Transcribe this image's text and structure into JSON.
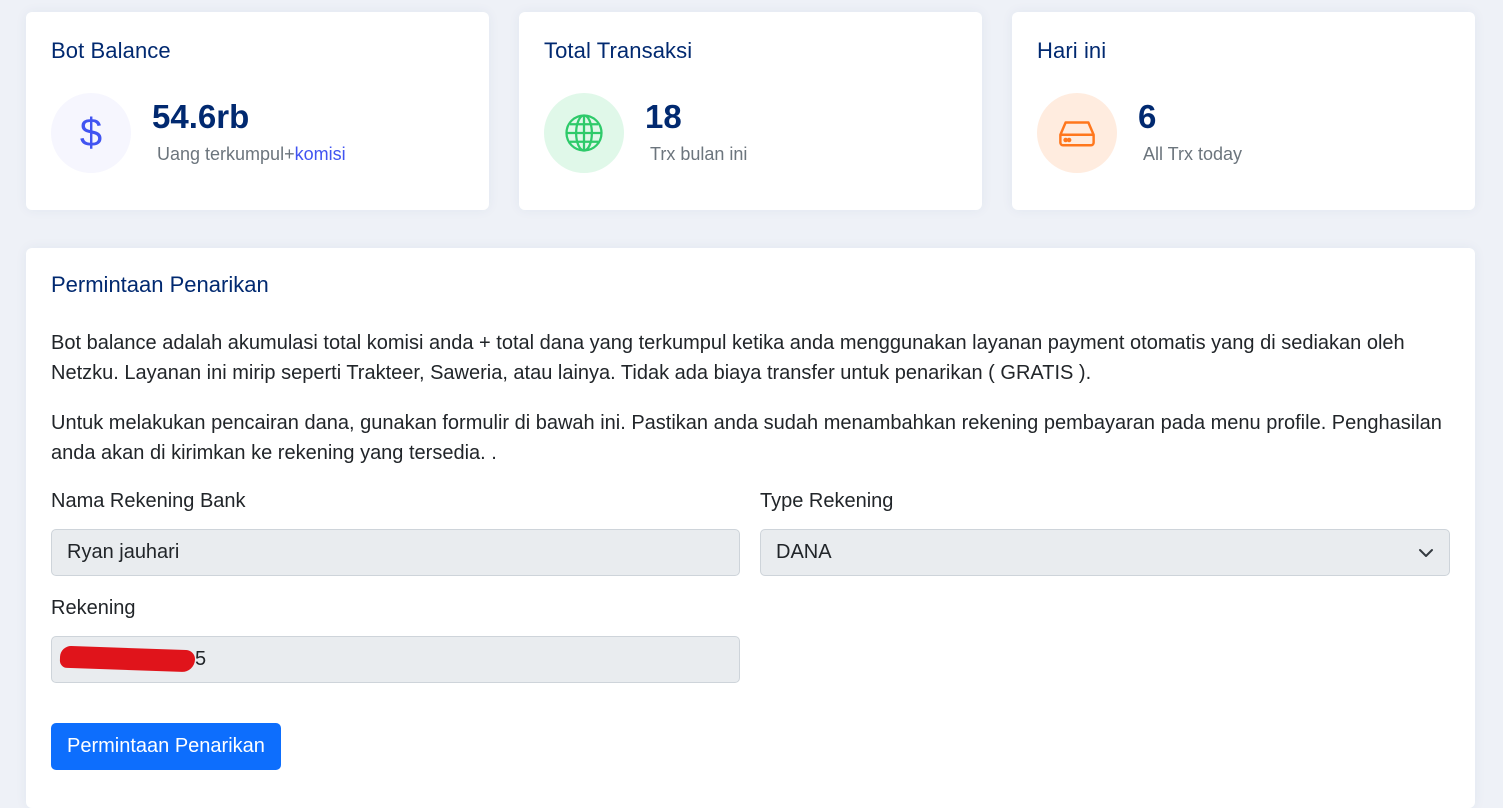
{
  "cards": {
    "balance": {
      "title": "Bot Balance",
      "icon": "dollar-icon",
      "value": "54.6rb",
      "sub_prefix": "Uang terkumpul+",
      "sub_accent": "komisi",
      "accent_color": "#4154f1"
    },
    "transactions": {
      "title": "Total Transaksi",
      "icon": "globe-icon",
      "value": "18",
      "sub": "Trx bulan ini",
      "accent_color": "#2eca6a"
    },
    "today": {
      "title": "Hari ini",
      "icon": "hdd-icon",
      "value": "6",
      "sub": "All Trx today",
      "accent_color": "#ff771d"
    }
  },
  "withdrawal": {
    "title": "Permintaan Penarikan",
    "paragraph1": "Bot balance adalah akumulasi total komisi anda + total dana yang terkumpul ketika anda menggunakan layanan payment otomatis yang di sediakan oleh Netzku. Layanan ini mirip seperti Trakteer, Saweria, atau lainya. Tidak ada biaya transfer untuk penarikan ( GRATIS ).",
    "paragraph2": "Untuk melakukan pencairan dana, gunakan formulir di bawah ini. Pastikan anda sudah menambahkan rekening pembayaran pada menu profile. Penghasilan anda akan di kirimkan ke rekening yang tersedia. .",
    "form": {
      "bank_name_label": "Nama Rekening Bank",
      "bank_name_value": "Ryan jauhari",
      "type_label": "Type Rekening",
      "type_value": "DANA",
      "account_label": "Rekening",
      "account_value_visible": "5"
    },
    "submit_label": "Permintaan Penarikan",
    "button_color": "#0d6efd"
  }
}
